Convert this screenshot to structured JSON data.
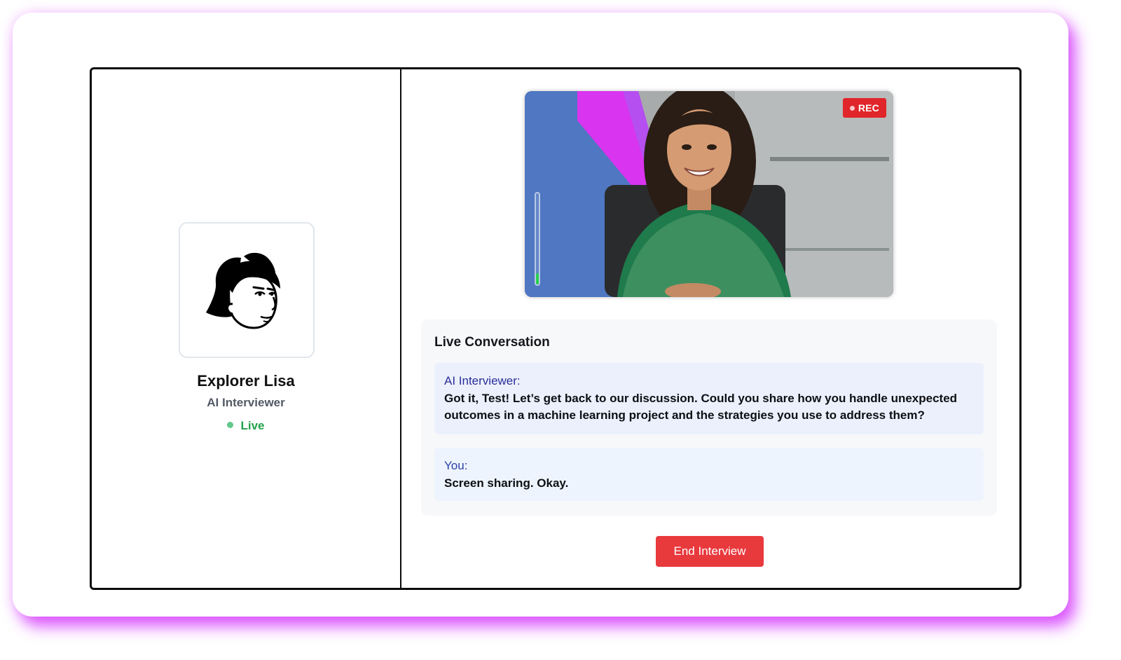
{
  "interviewer": {
    "name": "Explorer Lisa",
    "role": "AI Interviewer",
    "status": "Live",
    "status_color": "#22a14c",
    "avatar_icon": "woman-face-icon"
  },
  "video": {
    "rec_label": "REC",
    "rec_color": "#e0262a",
    "audio_level": 0.12
  },
  "conversation": {
    "title": "Live Conversation",
    "messages": [
      {
        "speaker": "AI Interviewer:",
        "text": "Got it, Test! Let’s get back to our discussion. Could you share how you handle unexpected outcomes in a machine learning project and the strategies you use to address them?"
      },
      {
        "speaker": "You:",
        "text": "Screen sharing. Okay."
      }
    ]
  },
  "actions": {
    "end_label": "End Interview",
    "end_color": "#e8393d"
  },
  "theme": {
    "glow": "#d63cff"
  }
}
